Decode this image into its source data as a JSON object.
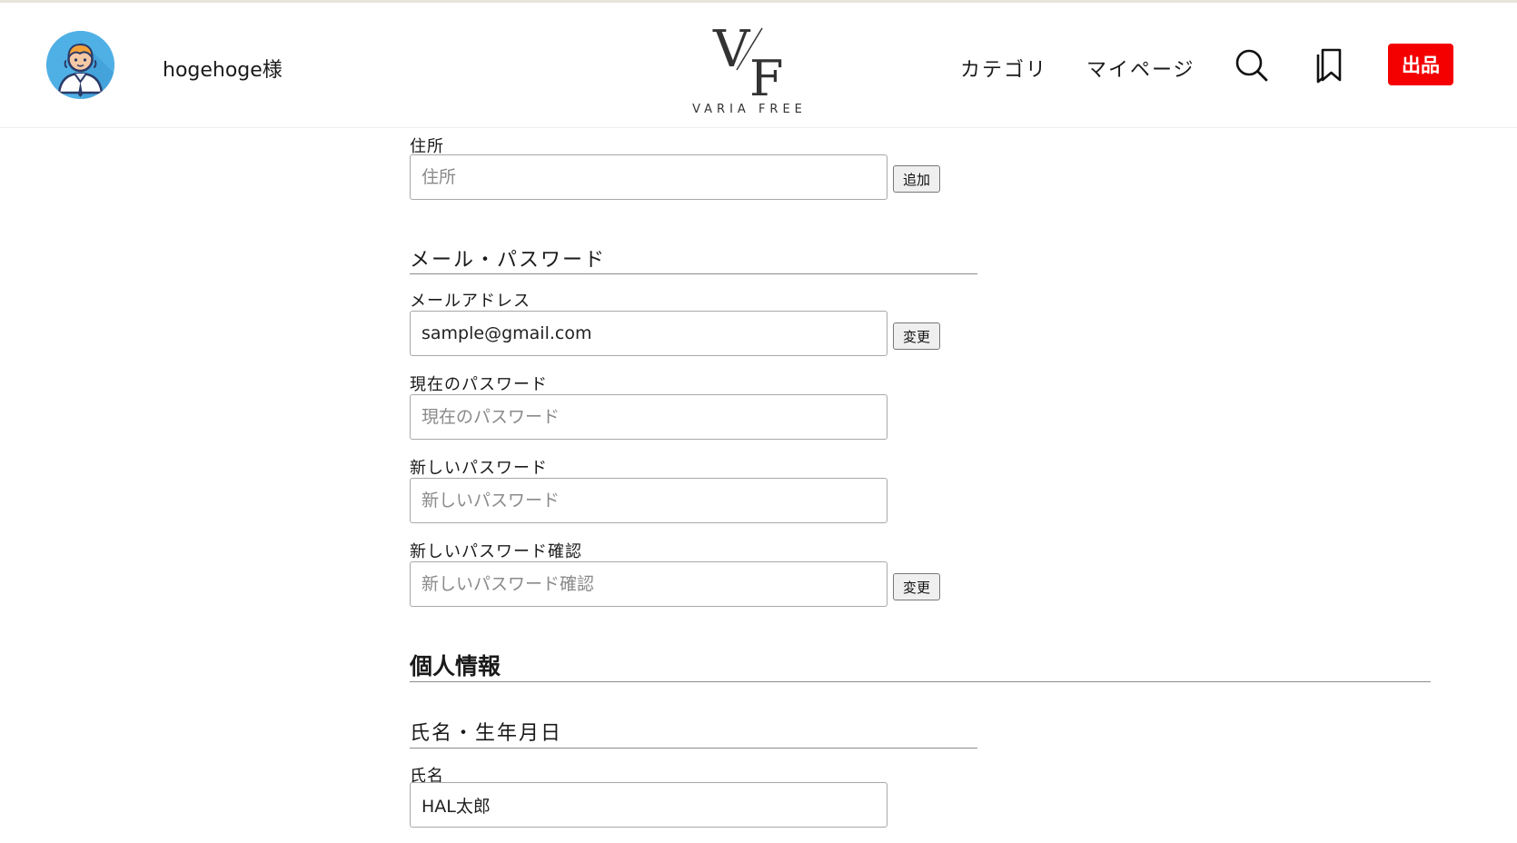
{
  "header": {
    "username": "hogehoge様",
    "logo": {
      "mark_v": "V",
      "mark_f": "F",
      "brand": "VARIA FREE"
    },
    "nav": {
      "category": "カテゴリ",
      "mypage": "マイページ"
    },
    "sell_label": "出品",
    "icons": [
      "user-avatar",
      "search-icon",
      "bookmark-icon"
    ]
  },
  "address": {
    "label": "住所",
    "placeholder": "住所",
    "value": "",
    "button": "追加"
  },
  "mail_password": {
    "section_title": "メール・パスワード",
    "email_label": "メールアドレス",
    "email_value": "sample@gmail.com",
    "email_button": "変更",
    "current_password_label": "現在のパスワード",
    "current_password_placeholder": "現在のパスワード",
    "new_password_label": "新しいパスワード",
    "new_password_placeholder": "新しいパスワード",
    "confirm_password_label": "新しいパスワード確認",
    "confirm_password_placeholder": "新しいパスワード確認",
    "password_button": "変更"
  },
  "personal": {
    "title": "個人情報",
    "name_section_title": "氏名・生年月日",
    "name_label": "氏名",
    "name_value": "HAL太郎"
  },
  "colors": {
    "accent": "#f50000",
    "avatar_bg": "#4fb0e6",
    "divider": "#8c8c8c"
  }
}
